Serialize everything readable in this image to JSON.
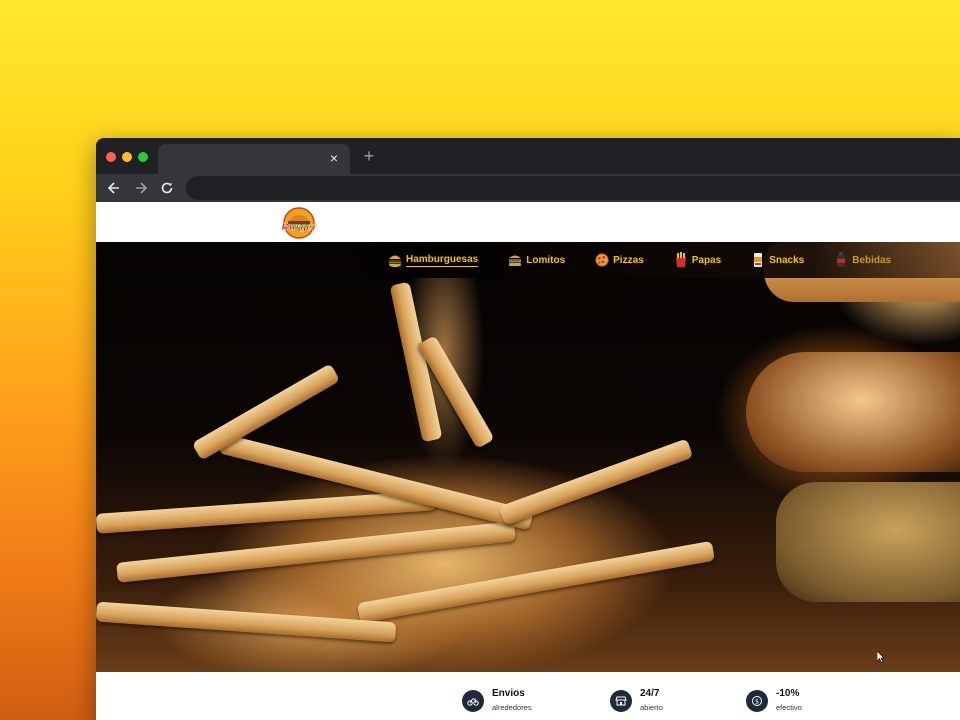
{
  "browser": {
    "tab_close": "×",
    "new_tab": "+"
  },
  "site": {
    "logo_text": "Burger",
    "nav": [
      {
        "label": "Hamburguesas",
        "icon": "burger-icon"
      },
      {
        "label": "Lomitos",
        "icon": "sandwich-icon"
      },
      {
        "label": "Pizzas",
        "icon": "pizza-icon"
      },
      {
        "label": "Papas",
        "icon": "fries-icon"
      },
      {
        "label": "Snacks",
        "icon": "snack-icon"
      },
      {
        "label": "Bebidas",
        "icon": "drink-icon"
      }
    ],
    "features": [
      {
        "title": "Envios",
        "subtitle": "alrededores",
        "icon": "bike-icon"
      },
      {
        "title": "24/7",
        "subtitle": "abierto",
        "icon": "store-icon"
      },
      {
        "title": "-10%",
        "subtitle": "efectivo",
        "icon": "cash-icon"
      }
    ]
  },
  "colors": {
    "nav_text": "#f5c400",
    "feature_icon_bg": "#1e2a3a"
  }
}
